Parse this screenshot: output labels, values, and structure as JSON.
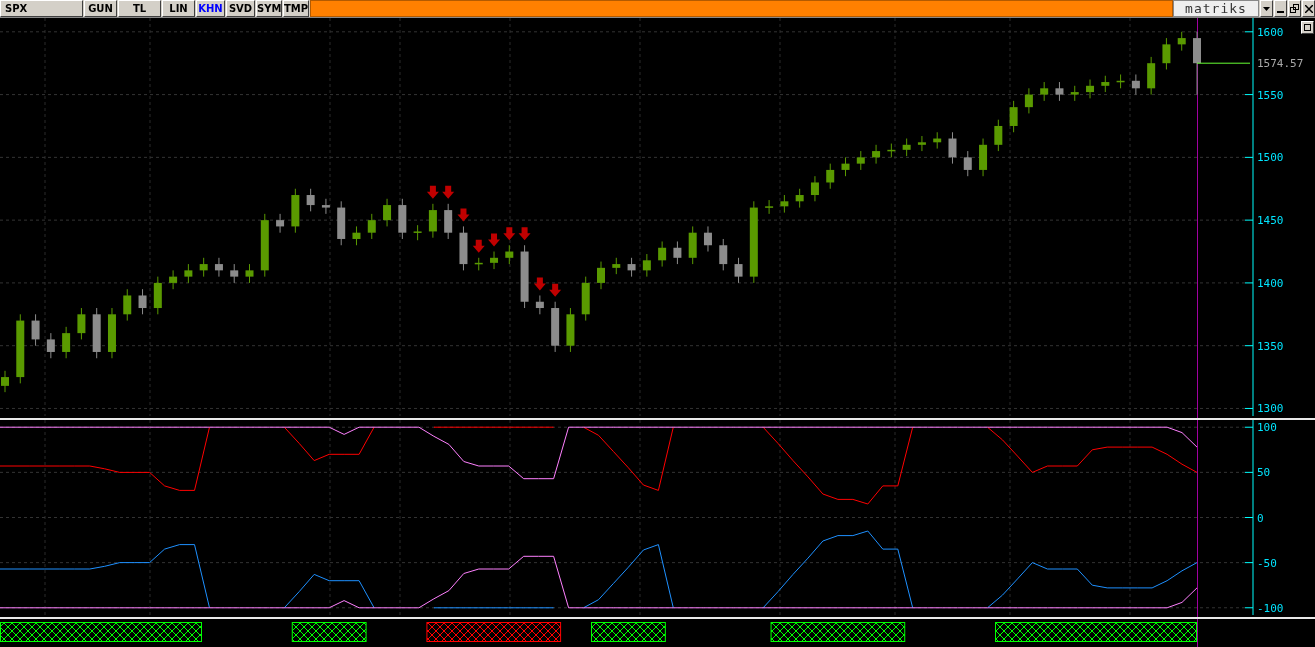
{
  "toolbar": {
    "symbol": "SPX",
    "buttons": [
      {
        "label": "GUN",
        "selected": false
      },
      {
        "label": "TL",
        "selected": false
      },
      {
        "label": "LIN",
        "selected": false
      },
      {
        "label": "KHN",
        "selected": true
      },
      {
        "label": "SVD",
        "selected": false
      },
      {
        "label": "SYM",
        "selected": false
      },
      {
        "label": "TMP",
        "selected": false
      }
    ],
    "logo": "matriks"
  },
  "price_panel": {
    "last_price": "1574.57",
    "candle_markers": [
      {
        "sell_arrow": false
      },
      {
        "sell_arrow": false
      },
      {
        "sell_arrow": false
      },
      {
        "sell_arrow": false
      },
      {
        "sell_arrow": false
      },
      {
        "sell_arrow": false
      },
      {
        "sell_arrow": false
      },
      {
        "sell_arrow": false
      },
      {
        "sell_arrow": false
      },
      {
        "sell_arrow": false
      },
      {
        "sell_arrow": false
      },
      {
        "sell_arrow": false
      },
      {
        "sell_arrow": false
      },
      {
        "sell_arrow": false
      },
      {
        "sell_arrow": false
      },
      {
        "sell_arrow": false
      },
      {
        "sell_arrow": false
      },
      {
        "sell_arrow": false
      },
      {
        "sell_arrow": false
      },
      {
        "sell_arrow": false
      },
      {
        "sell_arrow": false
      },
      {
        "sell_arrow": false
      },
      {
        "sell_arrow": false
      },
      {
        "sell_arrow": false
      },
      {
        "sell_arrow": false
      },
      {
        "sell_arrow": false
      },
      {
        "sell_arrow": false
      },
      {
        "sell_arrow": false
      },
      {
        "sell_arrow": true
      },
      {
        "sell_arrow": true
      },
      {
        "sell_arrow": true
      },
      {
        "sell_arrow": true
      },
      {
        "sell_arrow": true
      },
      {
        "sell_arrow": true
      },
      {
        "sell_arrow": true
      },
      {
        "sell_arrow": true
      },
      {
        "sell_arrow": true
      },
      {
        "sell_arrow": false
      },
      {
        "sell_arrow": false
      },
      {
        "sell_arrow": false
      },
      {
        "sell_arrow": false
      },
      {
        "sell_arrow": false
      },
      {
        "sell_arrow": false
      },
      {
        "sell_arrow": false
      },
      {
        "sell_arrow": false
      },
      {
        "sell_arrow": false
      },
      {
        "sell_arrow": false
      },
      {
        "sell_arrow": false
      },
      {
        "sell_arrow": false
      },
      {
        "sell_arrow": false
      },
      {
        "sell_arrow": false
      },
      {
        "sell_arrow": false
      },
      {
        "sell_arrow": false
      },
      {
        "sell_arrow": false
      },
      {
        "sell_arrow": false
      },
      {
        "sell_arrow": false
      },
      {
        "sell_arrow": false
      },
      {
        "sell_arrow": false
      },
      {
        "sell_arrow": false
      },
      {
        "sell_arrow": false
      },
      {
        "sell_arrow": false
      },
      {
        "sell_arrow": false
      },
      {
        "sell_arrow": false
      },
      {
        "sell_arrow": false
      },
      {
        "sell_arrow": false
      },
      {
        "sell_arrow": false
      },
      {
        "sell_arrow": false
      },
      {
        "sell_arrow": false
      },
      {
        "sell_arrow": false
      },
      {
        "sell_arrow": false
      },
      {
        "sell_arrow": false
      },
      {
        "sell_arrow": false
      },
      {
        "sell_arrow": false
      },
      {
        "sell_arrow": false
      },
      {
        "sell_arrow": false
      },
      {
        "sell_arrow": false
      },
      {
        "sell_arrow": false
      },
      {
        "sell_arrow": false
      },
      {
        "sell_arrow": false
      }
    ],
    "chart_data": {
      "type": "candlestick",
      "grid": true,
      "ylim": [
        1294,
        1611
      ],
      "yticks": [
        1300,
        1350,
        1400,
        1450,
        1500,
        1550,
        1600
      ],
      "ohlc": [
        [
          1318,
          1330,
          1313,
          1325
        ],
        [
          1325,
          1375,
          1320,
          1370
        ],
        [
          1370,
          1375,
          1350,
          1355
        ],
        [
          1355,
          1360,
          1340,
          1345
        ],
        [
          1345,
          1365,
          1340,
          1360
        ],
        [
          1360,
          1380,
          1355,
          1375
        ],
        [
          1375,
          1380,
          1340,
          1345
        ],
        [
          1345,
          1380,
          1340,
          1375
        ],
        [
          1375,
          1395,
          1370,
          1390
        ],
        [
          1390,
          1395,
          1375,
          1380
        ],
        [
          1380,
          1405,
          1375,
          1400
        ],
        [
          1400,
          1410,
          1395,
          1405
        ],
        [
          1405,
          1415,
          1400,
          1410
        ],
        [
          1410,
          1420,
          1405,
          1415
        ],
        [
          1415,
          1420,
          1405,
          1410
        ],
        [
          1410,
          1415,
          1400,
          1405
        ],
        [
          1405,
          1415,
          1400,
          1410
        ],
        [
          1410,
          1455,
          1405,
          1450
        ],
        [
          1450,
          1455,
          1440,
          1445
        ],
        [
          1445,
          1475,
          1440,
          1470
        ],
        [
          1470,
          1475,
          1457,
          1462
        ],
        [
          1462,
          1467,
          1455,
          1460
        ],
        [
          1460,
          1465,
          1430,
          1435
        ],
        [
          1435,
          1445,
          1430,
          1440
        ],
        [
          1440,
          1455,
          1435,
          1450
        ],
        [
          1450,
          1467,
          1445,
          1462
        ],
        [
          1462,
          1467,
          1435,
          1440
        ],
        [
          1440,
          1446,
          1434,
          1441
        ],
        [
          1441,
          1463,
          1436,
          1458
        ],
        [
          1458,
          1463,
          1435,
          1440
        ],
        [
          1440,
          1445,
          1410,
          1415
        ],
        [
          1415,
          1420,
          1410,
          1416
        ],
        [
          1416,
          1425,
          1411,
          1420
        ],
        [
          1420,
          1430,
          1415,
          1425
        ],
        [
          1425,
          1430,
          1380,
          1385
        ],
        [
          1385,
          1390,
          1375,
          1380
        ],
        [
          1380,
          1385,
          1345,
          1350
        ],
        [
          1350,
          1380,
          1345,
          1375
        ],
        [
          1375,
          1405,
          1370,
          1400
        ],
        [
          1400,
          1417,
          1395,
          1412
        ],
        [
          1412,
          1420,
          1407,
          1415
        ],
        [
          1415,
          1420,
          1405,
          1410
        ],
        [
          1410,
          1423,
          1405,
          1418
        ],
        [
          1418,
          1433,
          1413,
          1428
        ],
        [
          1428,
          1433,
          1415,
          1420
        ],
        [
          1420,
          1445,
          1415,
          1440
        ],
        [
          1440,
          1445,
          1425,
          1430
        ],
        [
          1430,
          1435,
          1410,
          1415
        ],
        [
          1415,
          1420,
          1400,
          1405
        ],
        [
          1405,
          1465,
          1400,
          1460
        ],
        [
          1460,
          1466,
          1455,
          1461
        ],
        [
          1461,
          1470,
          1456,
          1465
        ],
        [
          1465,
          1475,
          1460,
          1470
        ],
        [
          1470,
          1485,
          1465,
          1480
        ],
        [
          1480,
          1495,
          1475,
          1490
        ],
        [
          1490,
          1500,
          1485,
          1495
        ],
        [
          1495,
          1505,
          1490,
          1500
        ],
        [
          1500,
          1510,
          1495,
          1505
        ],
        [
          1505,
          1511,
          1500,
          1506
        ],
        [
          1506,
          1515,
          1501,
          1510
        ],
        [
          1510,
          1517,
          1505,
          1512
        ],
        [
          1512,
          1520,
          1507,
          1515
        ],
        [
          1515,
          1520,
          1495,
          1500
        ],
        [
          1500,
          1505,
          1485,
          1490
        ],
        [
          1490,
          1515,
          1485,
          1510
        ],
        [
          1510,
          1530,
          1505,
          1525
        ],
        [
          1525,
          1545,
          1520,
          1540
        ],
        [
          1540,
          1555,
          1535,
          1550
        ],
        [
          1550,
          1560,
          1545,
          1555
        ],
        [
          1555,
          1560,
          1545,
          1550
        ],
        [
          1550,
          1557,
          1545,
          1552
        ],
        [
          1552,
          1562,
          1547,
          1557
        ],
        [
          1557,
          1565,
          1552,
          1560
        ],
        [
          1560,
          1566,
          1555,
          1561
        ],
        [
          1561,
          1566,
          1550,
          1555
        ],
        [
          1555,
          1580,
          1550,
          1575
        ],
        [
          1575,
          1595,
          1570,
          1590
        ],
        [
          1590,
          1600,
          1585,
          1595
        ],
        [
          1595,
          1600,
          1550,
          1575
        ]
      ]
    }
  },
  "oscillator_panel": {
    "chart_data": {
      "type": "line",
      "grid": true,
      "ylim": [
        -108,
        108
      ],
      "yticks": [
        -100,
        -50,
        0,
        50,
        100
      ],
      "series": [
        {
          "color": "#ff0000",
          "values": [
            57,
            57,
            57,
            57,
            57,
            57,
            57,
            54,
            50,
            50,
            50,
            35,
            30,
            30,
            100,
            null,
            null,
            null,
            null,
            100,
            82,
            63,
            70,
            70,
            70,
            100,
            null,
            null,
            null,
            100,
            100,
            100,
            100,
            100,
            100,
            100,
            100,
            100,
            null,
            100,
            91,
            73,
            55,
            36,
            30,
            100,
            null,
            null,
            null,
            null,
            null,
            100,
            82,
            63,
            45,
            26,
            20,
            20,
            15,
            35,
            35,
            100,
            null,
            null,
            null,
            null,
            100,
            86,
            68,
            50,
            57,
            57,
            57,
            75,
            78,
            78,
            78,
            78,
            70,
            59,
            50
          ]
        },
        {
          "color": "#1e90ff",
          "values": [
            -57,
            -57,
            -57,
            -57,
            -57,
            -57,
            -57,
            -54,
            -50,
            -50,
            -50,
            -35,
            -30,
            -30,
            -100,
            null,
            null,
            null,
            null,
            -100,
            -82,
            -63,
            -70,
            -70,
            -70,
            -100,
            null,
            null,
            null,
            -100,
            -100,
            -100,
            -100,
            -100,
            -100,
            -100,
            -100,
            -100,
            null,
            -100,
            -91,
            -73,
            -55,
            -36,
            -30,
            -100,
            null,
            null,
            null,
            null,
            null,
            -100,
            -82,
            -63,
            -45,
            -26,
            -20,
            -20,
            -15,
            -35,
            -35,
            -100,
            null,
            null,
            null,
            null,
            -100,
            -86,
            -68,
            -50,
            -57,
            -57,
            -57,
            -75,
            -78,
            -78,
            -78,
            -78,
            -70,
            -59,
            -50
          ]
        },
        {
          "color": "#ff80ff",
          "values": [
            100,
            100,
            100,
            100,
            100,
            100,
            100,
            100,
            100,
            100,
            100,
            100,
            100,
            100,
            100,
            100,
            100,
            100,
            100,
            100,
            100,
            100,
            100,
            92,
            100,
            100,
            100,
            100,
            100,
            90,
            81,
            62,
            57,
            57,
            57,
            43,
            43,
            43,
            100,
            100,
            100,
            100,
            100,
            100,
            100,
            100,
            100,
            100,
            100,
            100,
            100,
            100,
            100,
            100,
            100,
            100,
            100,
            100,
            100,
            100,
            100,
            100,
            100,
            100,
            100,
            100,
            100,
            100,
            100,
            100,
            100,
            100,
            100,
            100,
            100,
            100,
            100,
            100,
            100,
            94,
            78
          ]
        },
        {
          "color": "#ff80ff",
          "values": [
            -100,
            -100,
            -100,
            -100,
            -100,
            -100,
            -100,
            -100,
            -100,
            -100,
            -100,
            -100,
            -100,
            -100,
            -100,
            -100,
            -100,
            -100,
            -100,
            -100,
            -100,
            -100,
            -100,
            -92,
            -100,
            -100,
            -100,
            -100,
            -100,
            -90,
            -81,
            -62,
            -57,
            -57,
            -57,
            -43,
            -43,
            -43,
            -100,
            -100,
            -100,
            -100,
            -100,
            -100,
            -100,
            -100,
            -100,
            -100,
            -100,
            -100,
            -100,
            -100,
            -100,
            -100,
            -100,
            -100,
            -100,
            -100,
            -100,
            -100,
            -100,
            -100,
            -100,
            -100,
            -100,
            -100,
            -100,
            -100,
            -100,
            -100,
            -100,
            -100,
            -100,
            -100,
            -100,
            -100,
            -100,
            -100,
            -100,
            -94,
            -78
          ]
        }
      ]
    }
  }
}
